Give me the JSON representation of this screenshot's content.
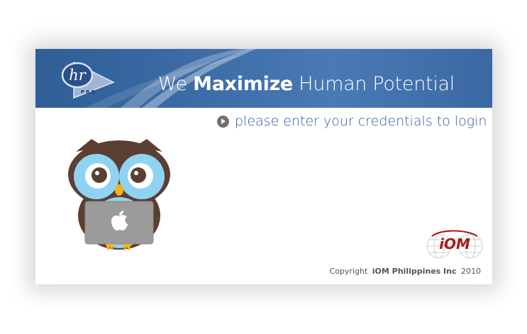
{
  "header": {
    "tagline_prefix": "We",
    "tagline_emphasis": "Maximize",
    "tagline_suffix": "Human Potential",
    "logo_text": "hr",
    "logo_subtext": "PRO"
  },
  "login": {
    "prompt": "please enter your credentials to login"
  },
  "footer": {
    "copyright_label": "Copyright",
    "company": "iOM Philippines Inc",
    "year": "2010",
    "logo_text": "iOM"
  },
  "icons": {
    "prompt": "arrow-circle-icon",
    "mascot": "owl-with-laptop-icon",
    "laptop": "apple-logo-icon"
  },
  "colors": {
    "header_blue": "#3c6ca6",
    "prompt_text": "#2e5a94",
    "iom_red": "#a51c1c",
    "owl_brown": "#5a3f32",
    "owl_eye_blue": "#8fd3f2"
  }
}
